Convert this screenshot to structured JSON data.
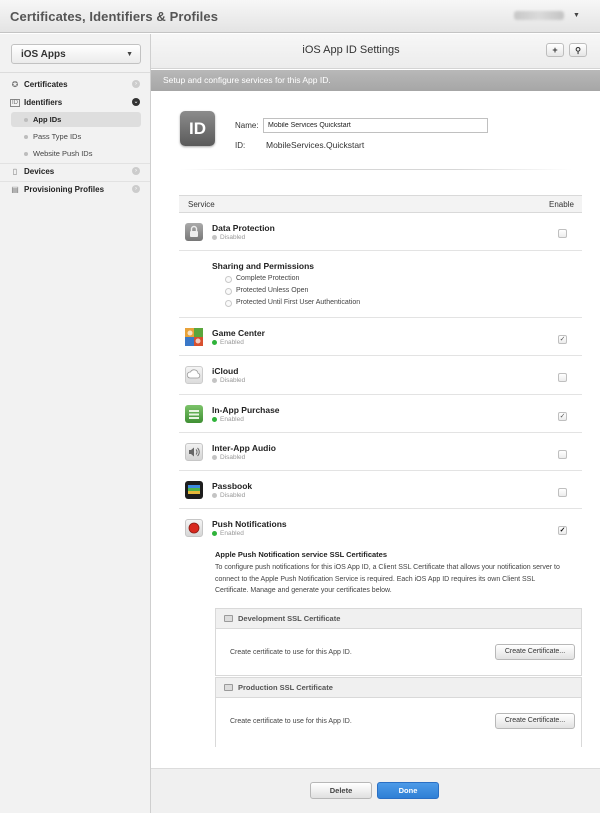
{
  "header": {
    "app_title": "Certificates, Identifiers & Profiles"
  },
  "sidebar": {
    "platform": "iOS Apps",
    "sections": [
      {
        "label": "Certificates",
        "icon": "certificate-badge-icon"
      },
      {
        "label": "Identifiers",
        "icon": "id-card-icon"
      },
      {
        "label": "Devices",
        "icon": "device-icon"
      },
      {
        "label": "Provisioning Profiles",
        "icon": "profile-document-icon"
      }
    ],
    "identifier_items": [
      "App IDs",
      "Pass Type IDs",
      "Website Push IDs"
    ],
    "selected_item": "App IDs"
  },
  "main": {
    "title": "iOS App ID Settings",
    "subtitle": "Setup and configure services for this App ID.",
    "app_icon_text": "ID",
    "name_label": "Name:",
    "name_value": "Mobile Services Quickstart",
    "id_label": "ID:",
    "id_value": "MobileServices.Quickstart",
    "service_col": "Service",
    "enable_col": "Enable"
  },
  "services": [
    {
      "name": "Data Protection",
      "status": "Disabled",
      "checked": false
    },
    {
      "name": "Game Center",
      "status": "Enabled",
      "checked": true
    },
    {
      "name": "iCloud",
      "status": "Disabled",
      "checked": false
    },
    {
      "name": "In-App Purchase",
      "status": "Enabled",
      "checked": true
    },
    {
      "name": "Inter-App Audio",
      "status": "Disabled",
      "checked": false
    },
    {
      "name": "Passbook",
      "status": "Disabled",
      "checked": false
    },
    {
      "name": "Push Notifications",
      "status": "Enabled",
      "checked": true
    }
  ],
  "sharing": {
    "title": "Sharing and Permissions",
    "options": [
      "Complete Protection",
      "Protected Unless Open",
      "Protected Until First User Authentication"
    ]
  },
  "apns": {
    "title": "Apple Push Notification service SSL Certificates",
    "description": "To configure push notifications for this iOS App ID, a Client SSL Certificate that allows your notification server to connect to the Apple Push Notification Service is required. Each iOS App ID requires its own Client SSL Certificate. Manage and generate your certificates below.",
    "development": {
      "title": "Development SSL Certificate",
      "text": "Create certificate to use for this App ID.",
      "button": "Create Certificate..."
    },
    "production": {
      "title": "Production SSL Certificate",
      "text": "Create certificate to use for this App ID.",
      "button": "Create Certificate..."
    }
  },
  "footer": {
    "delete_label": "Delete",
    "done_label": "Done"
  },
  "colors": {
    "enabled_dot": "#2fb33a",
    "disabled_dot": "#c4c4c4",
    "done_button": "#2f7fd5",
    "subtitle_bar": "#aeaeae"
  }
}
